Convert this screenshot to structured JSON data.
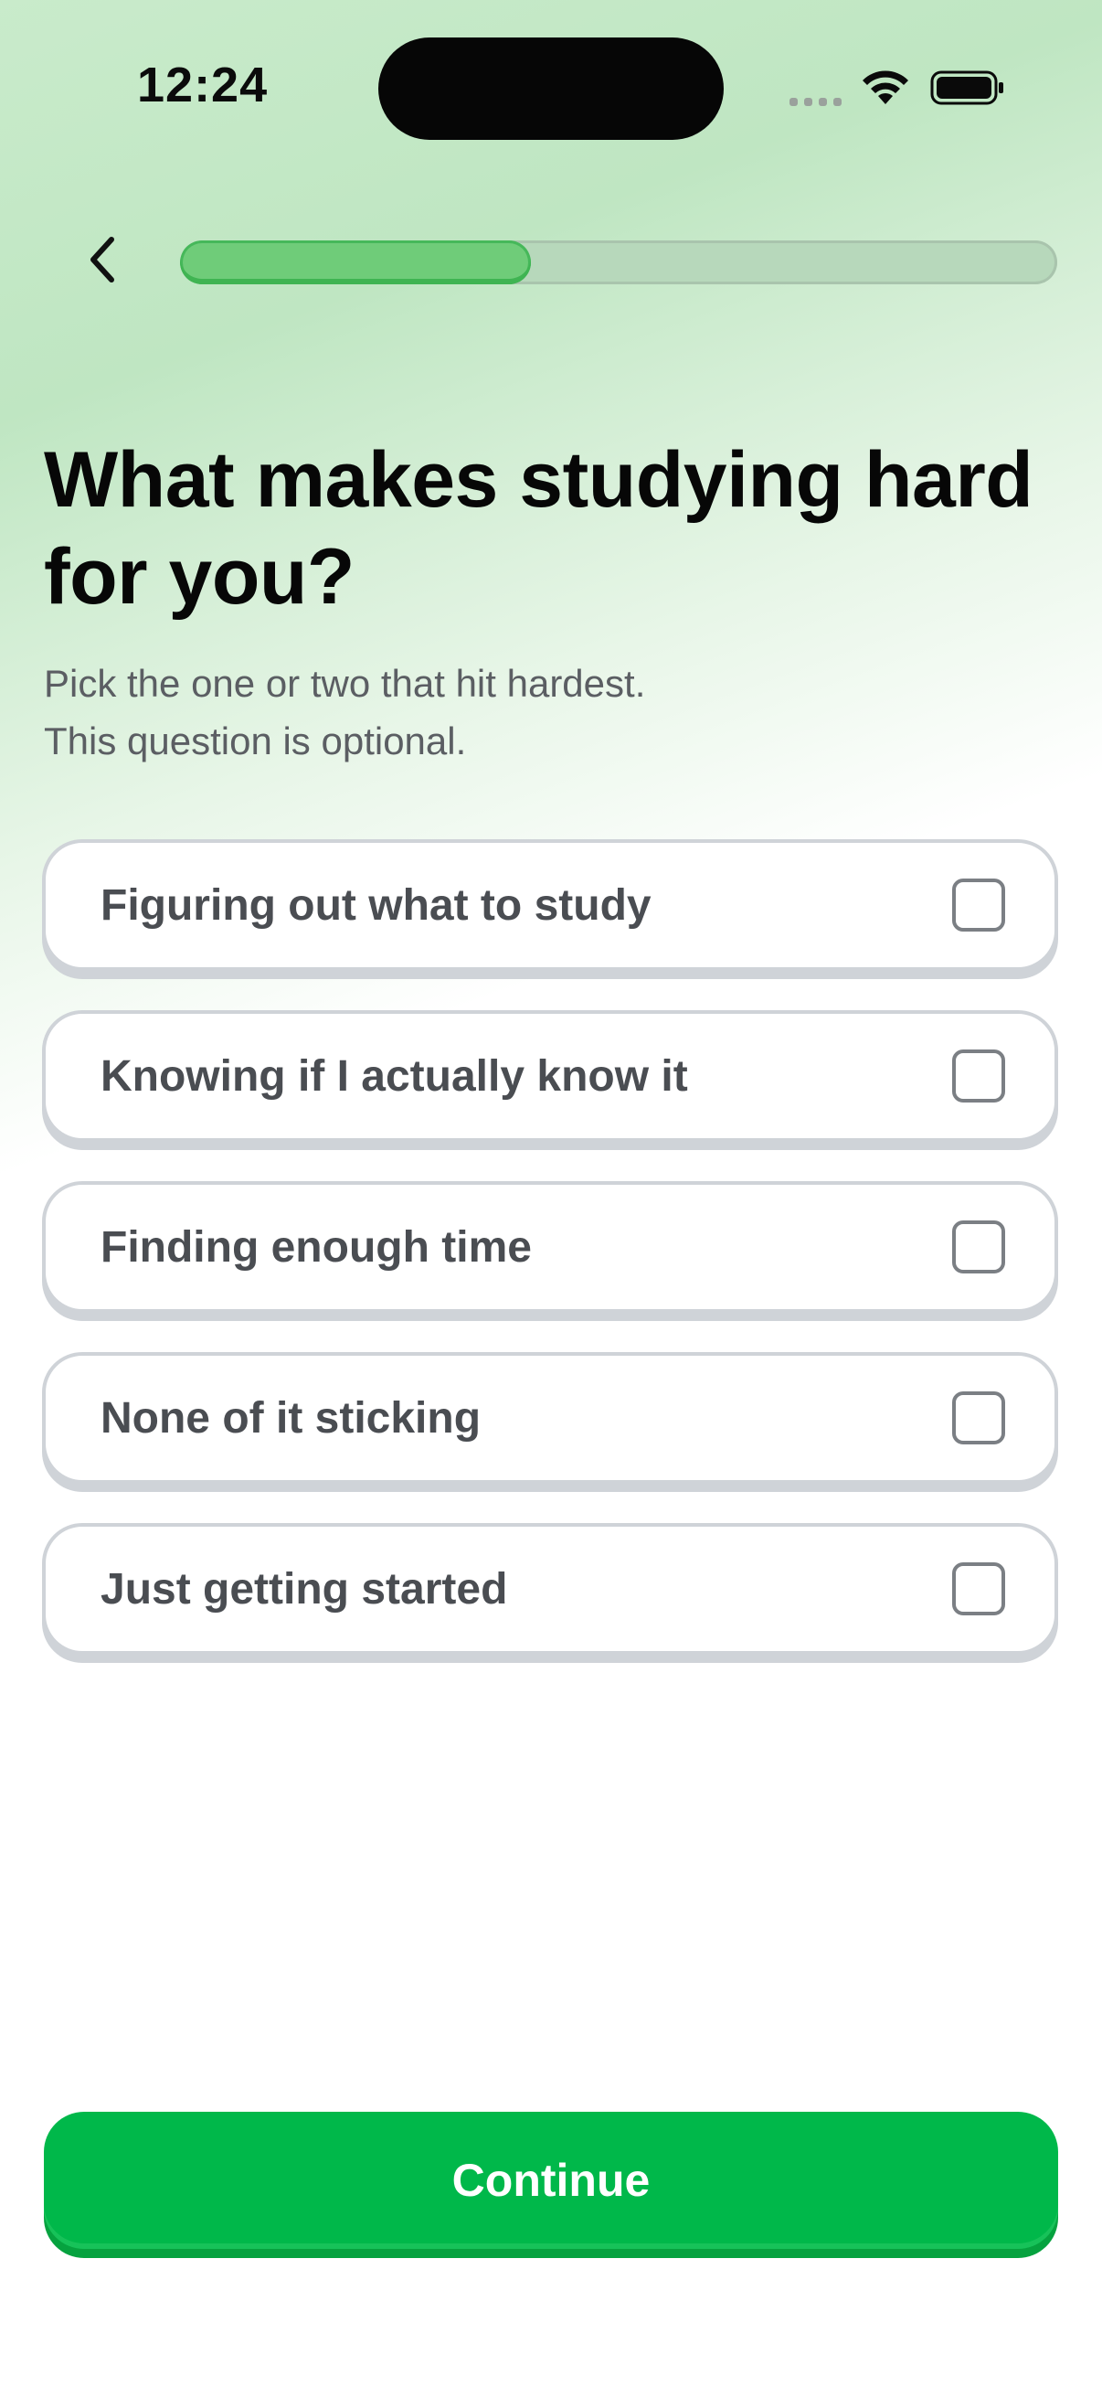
{
  "status_bar": {
    "time": "12:24",
    "icons": [
      "signal-dots-icon",
      "wifi-icon",
      "battery-icon"
    ]
  },
  "header": {
    "back_icon": "chevron-left-icon",
    "progress_fraction": 0.4
  },
  "question": {
    "title": "What makes studying hard for you?",
    "subtitle_lines": [
      "Pick the one or two that hit hardest.",
      "This question is optional."
    ]
  },
  "options": [
    {
      "label": "Figuring out what to study",
      "checked": false
    },
    {
      "label": "Knowing if I actually know it",
      "checked": false
    },
    {
      "label": "Finding enough time",
      "checked": false
    },
    {
      "label": "None of it sticking",
      "checked": false
    },
    {
      "label": "Just getting started",
      "checked": false
    }
  ],
  "footer": {
    "continue_label": "Continue"
  },
  "colors": {
    "accent_green": "#00b84a",
    "progress_fill": "#6fcc79",
    "progress_track": "#b7d8bb",
    "option_border": "#cfd3d8",
    "background_top": "#c9ebcb"
  }
}
